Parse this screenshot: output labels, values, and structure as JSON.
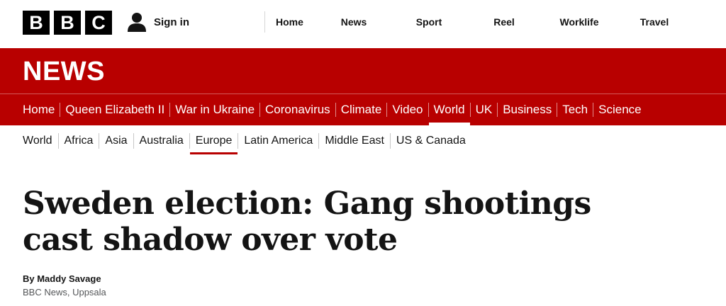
{
  "brand": {
    "letters": [
      "B",
      "B",
      "C"
    ]
  },
  "account": {
    "signin_label": "Sign in"
  },
  "global_nav": [
    "Home",
    "News",
    "Sport",
    "Reel",
    "Worklife",
    "Travel"
  ],
  "news_band": {
    "title": "NEWS",
    "background_color": "#b80000",
    "sections": [
      "Home",
      "Queen Elizabeth II",
      "War in Ukraine",
      "Coronavirus",
      "Climate",
      "Video",
      "World",
      "UK",
      "Business",
      "Tech",
      "Science"
    ],
    "active_section": "World"
  },
  "sub_nav": {
    "items": [
      "World",
      "Africa",
      "Asia",
      "Australia",
      "Europe",
      "Latin America",
      "Middle East",
      "US & Canada"
    ],
    "active_item": "Europe"
  },
  "article": {
    "headline_line1": "Sweden election: Gang shootings",
    "headline_line2": "cast shadow over vote",
    "author": "By Maddy Savage",
    "author_role": "BBC News, Uppsala"
  }
}
